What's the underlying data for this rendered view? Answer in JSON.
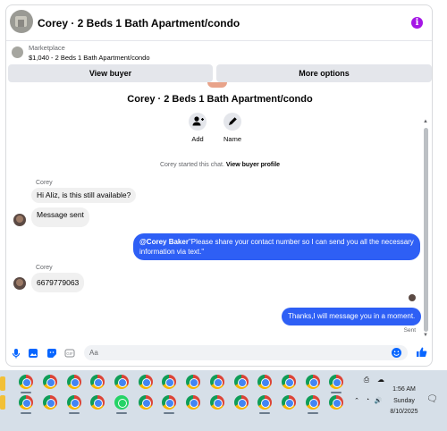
{
  "header": {
    "title": "Corey · 2 Beds 1 Bath Apartment/condo",
    "info_glyph": "i"
  },
  "marketplace": {
    "label": "Marketplace",
    "listing": "$1,040 - 2 Beds 1 Bath Apartment/condo"
  },
  "actions": {
    "view_buyer": "View buyer",
    "more_options": "More options"
  },
  "profile": {
    "name": "Corey · 2 Beds 1 Bath Apartment/condo",
    "add_label": "Add",
    "name_label": "Name"
  },
  "system_note": {
    "text": "Corey started this chat.",
    "link": "View buyer profile"
  },
  "messages": {
    "sender1": "Corey",
    "in1": "Hi Aliz, is this still available?",
    "in2": "Message sent",
    "out1_mention": "@Corey Baker",
    "out1_text": "\"Please share your contact number so I can send you all the necessary information via text.\"",
    "sender2": "Corey",
    "in3": "6679779063",
    "out2": "Thanks,I will message you in a moment.",
    "status": "Sent"
  },
  "composer": {
    "placeholder": "Aa"
  },
  "taskbar": {
    "time": "1:56 AM",
    "day": "Sunday",
    "date": "8/10/2025"
  },
  "colors": {
    "accent": "#2e5ff5",
    "info": "#a516e6",
    "link_blue": "#0866ff"
  }
}
